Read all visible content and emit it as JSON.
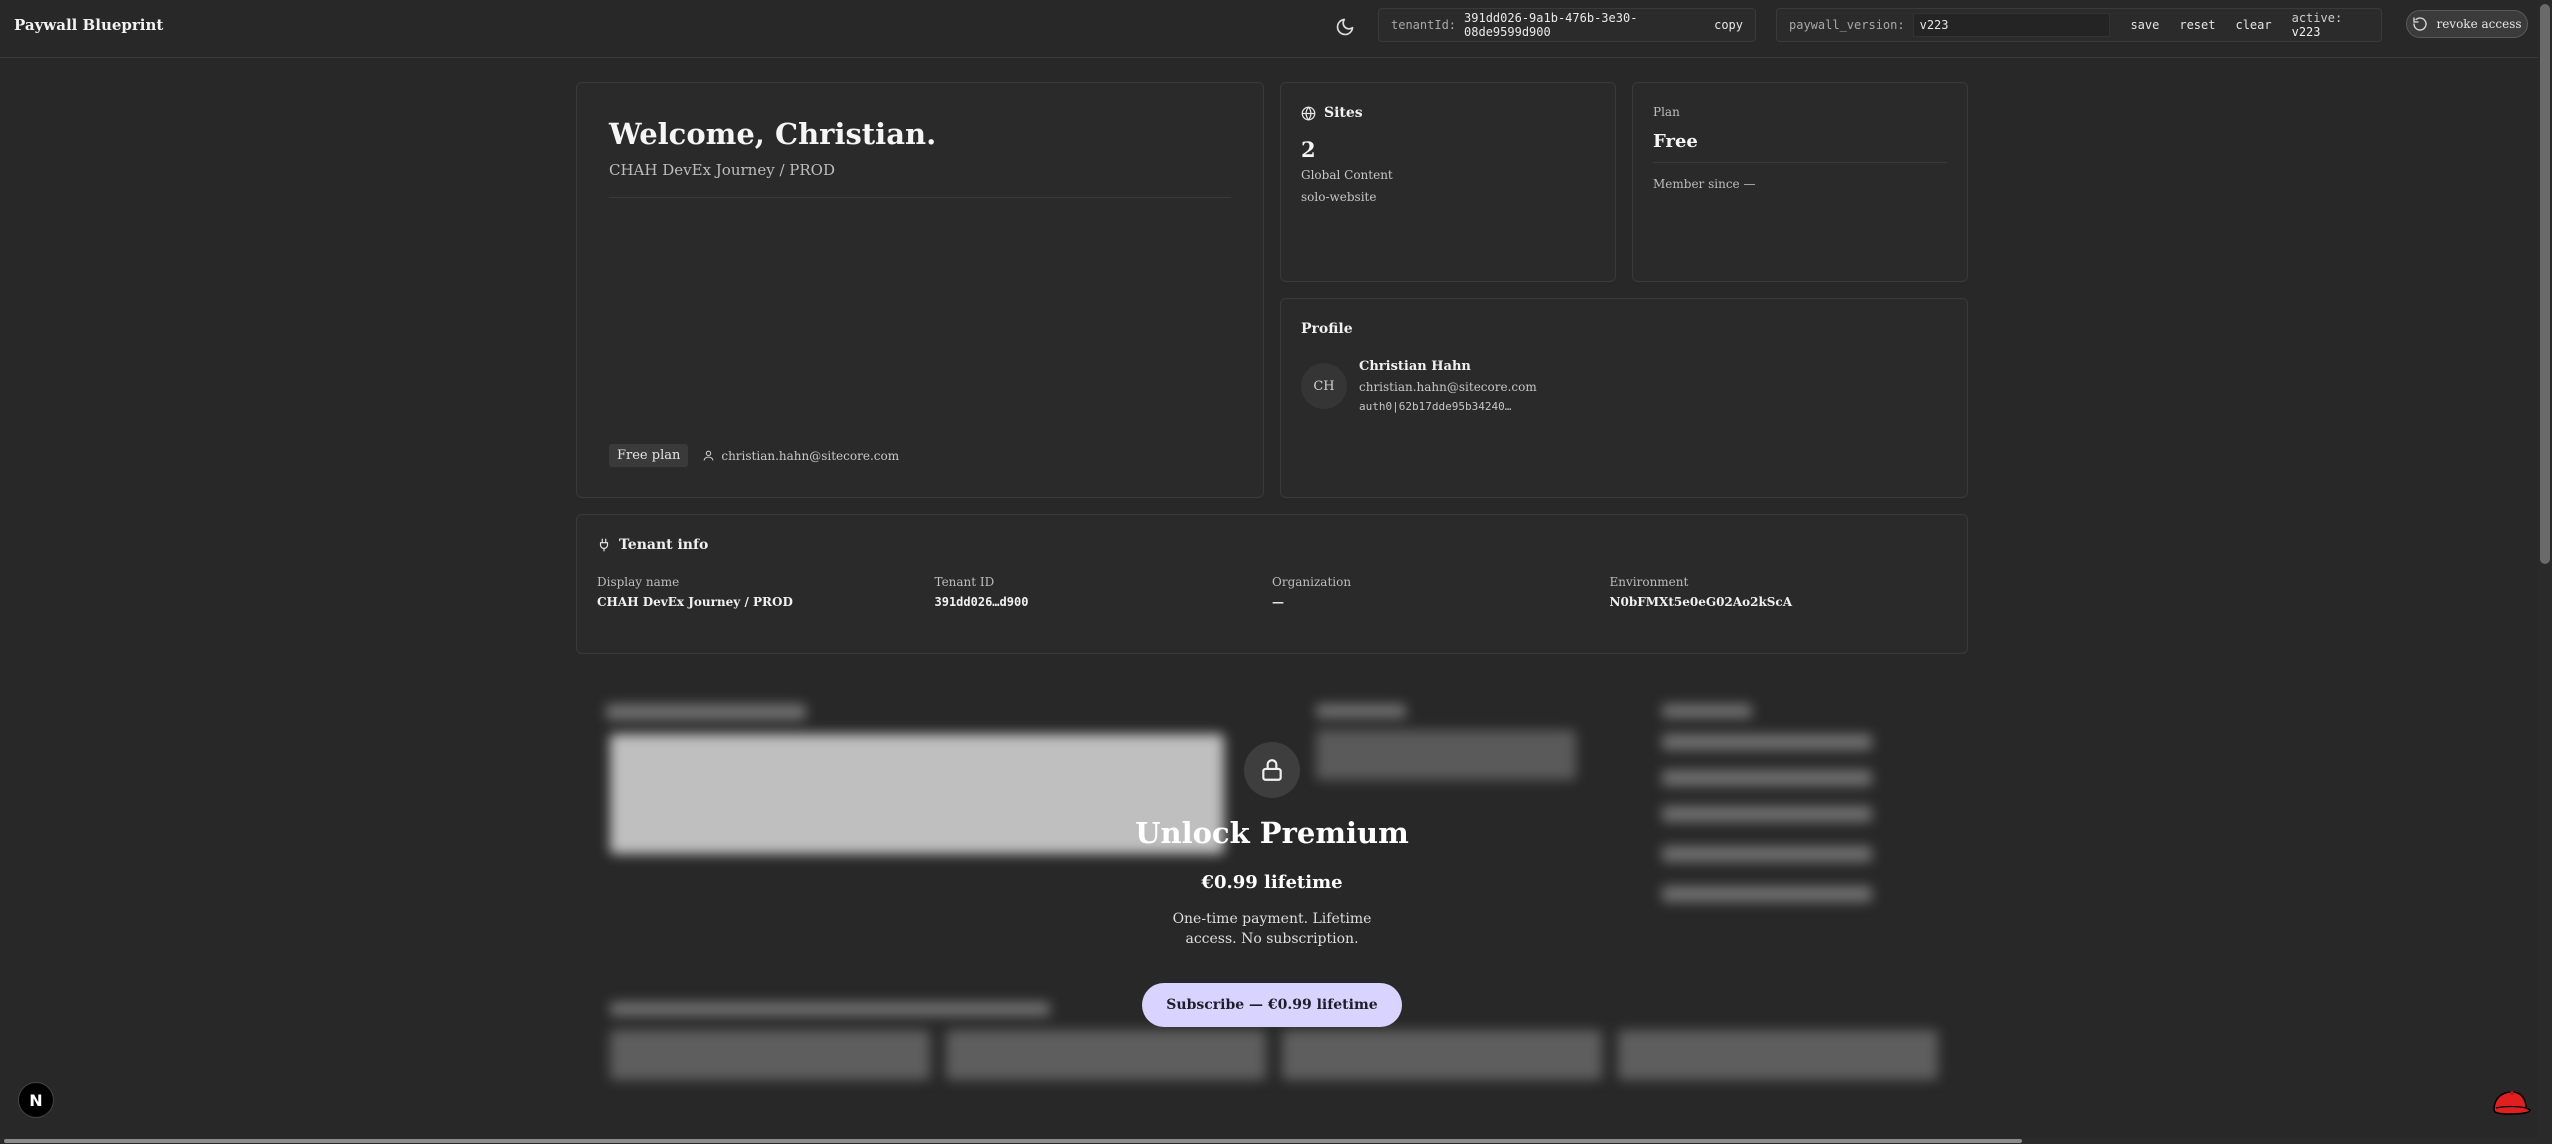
{
  "header": {
    "brand": "Paywall Blueprint",
    "tenant_label": "tenantId:",
    "tenant_value": "391dd026-9a1b-476b-3e30-08de9599d900",
    "copy_label": "copy",
    "version_label": "paywall_version:",
    "version_value": "v223",
    "save_label": "save",
    "reset_label": "reset",
    "clear_label": "clear",
    "active_label": "active:",
    "active_value": "v223",
    "revoke_label": "revoke access"
  },
  "welcome": {
    "title": "Welcome, Christian.",
    "subtitle": "CHAH DevEx Journey / PROD",
    "plan_badge": "Free plan",
    "email": "christian.hahn@sitecore.com"
  },
  "sites": {
    "title": "Sites",
    "count": "2",
    "items": [
      "Global Content",
      "solo-website"
    ]
  },
  "plan": {
    "label": "Plan",
    "value": "Free",
    "member_since": "Member since —"
  },
  "profile": {
    "title": "Profile",
    "initials": "CH",
    "name": "Christian Hahn",
    "email": "christian.hahn@sitecore.com",
    "user_id": "auth0|62b17dde95b34240…"
  },
  "tenant_info": {
    "title": "Tenant info",
    "fields": [
      {
        "label": "Display name",
        "value": "CHAH DevEx Journey / PROD"
      },
      {
        "label": "Tenant ID",
        "value": "391dd026…d900"
      },
      {
        "label": "Organization",
        "value": "—"
      },
      {
        "label": "Environment",
        "value": "N0bFMXt5e0eG02Ao2kScA"
      }
    ]
  },
  "paywall": {
    "title": "Unlock Premium",
    "price": "€0.99 lifetime",
    "description": "One-time payment. Lifetime access. No subscription.",
    "cta": "Subscribe — €0.99 lifetime"
  },
  "dev_badge": "N",
  "colors": {
    "background": "#282828",
    "card": "#2a2a2a",
    "border": "#3a3a3a",
    "cta": "#d8d4ff",
    "cap_red": "#e02020"
  }
}
